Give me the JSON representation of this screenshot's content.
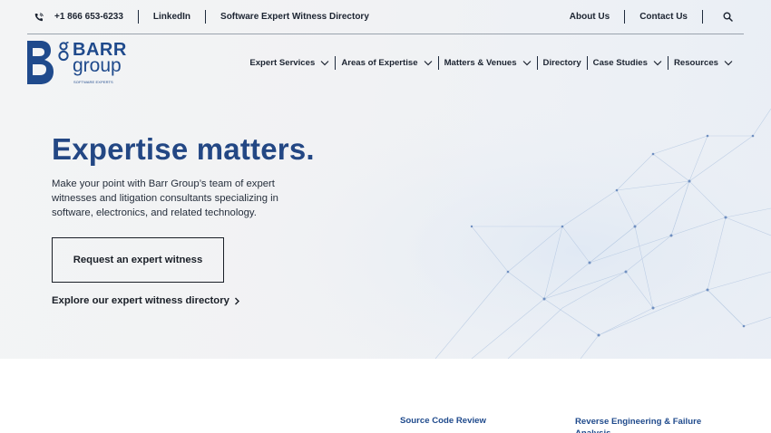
{
  "colors": {
    "brand_blue": "#234784",
    "text_dark": "#1c2431",
    "hero_bg": "#f2f3f5"
  },
  "utility_bar": {
    "phone": "+1 866 653-6233",
    "linkedin": "LinkedIn",
    "directory": "Software Expert Witness Directory",
    "about": "About Us",
    "contact": "Contact Us",
    "icons": [
      "phone-icon",
      "search-icon"
    ]
  },
  "logo": {
    "line1": "BARR",
    "line2": "group",
    "tagline": "SOFTWARE EXPERTS"
  },
  "nav": {
    "expert_services": "Expert Services",
    "areas": "Areas of Expertise",
    "matters": "Matters & Venues",
    "directory": "Directory",
    "case_studies": "Case Studies",
    "resources": "Resources"
  },
  "hero": {
    "title": "Expertise matters.",
    "description": "Make your point with Barr Group’s team of expert witnesses and litigation consultants specializing in software, electronics, and related technology.",
    "cta": "Request an expert witness",
    "link": "Explore our expert witness directory"
  },
  "services": {
    "col1": "Source Code Review",
    "col2": "Reverse Engineering & Failure Analysis"
  }
}
